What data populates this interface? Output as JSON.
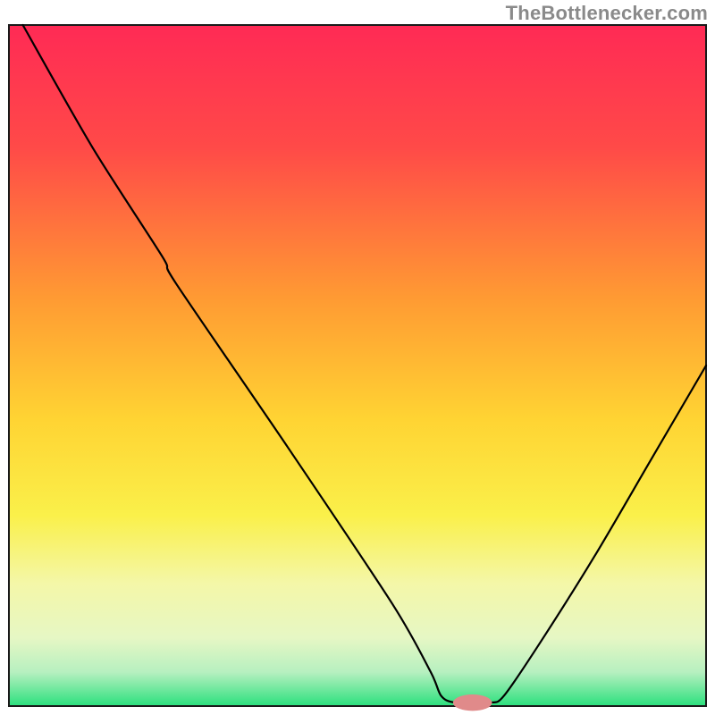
{
  "attribution": "TheBottlenecker.com",
  "chart_data": {
    "type": "line",
    "title": "",
    "xlabel": "",
    "ylabel": "",
    "xlim": [
      0,
      100
    ],
    "ylim": [
      0,
      100
    ],
    "background_gradient_stops": [
      {
        "offset": 0,
        "color": "#ff2a55"
      },
      {
        "offset": 18,
        "color": "#ff4a48"
      },
      {
        "offset": 40,
        "color": "#ff9a33"
      },
      {
        "offset": 58,
        "color": "#ffd433"
      },
      {
        "offset": 72,
        "color": "#faf04a"
      },
      {
        "offset": 82,
        "color": "#f4f7a8"
      },
      {
        "offset": 90,
        "color": "#e6f7c4"
      },
      {
        "offset": 95,
        "color": "#b7f0c0"
      },
      {
        "offset": 100,
        "color": "#2be07d"
      }
    ],
    "series": [
      {
        "name": "bottleneck-curve",
        "color": "#000000",
        "data": [
          {
            "x": 2.0,
            "y": 100.0
          },
          {
            "x": 12.0,
            "y": 82.0
          },
          {
            "x": 22.0,
            "y": 66.0
          },
          {
            "x": 24.0,
            "y": 62.0
          },
          {
            "x": 40.0,
            "y": 38.0
          },
          {
            "x": 55.0,
            "y": 15.0
          },
          {
            "x": 60.5,
            "y": 5.0
          },
          {
            "x": 62.0,
            "y": 1.5
          },
          {
            "x": 64.0,
            "y": 0.5
          },
          {
            "x": 69.0,
            "y": 0.5
          },
          {
            "x": 71.0,
            "y": 1.5
          },
          {
            "x": 76.0,
            "y": 9.0
          },
          {
            "x": 84.0,
            "y": 22.0
          },
          {
            "x": 92.0,
            "y": 36.0
          },
          {
            "x": 100.0,
            "y": 50.0
          }
        ]
      }
    ],
    "marker": {
      "name": "optimal-point",
      "x": 66.5,
      "y": 0.5,
      "rx": 2.8,
      "ry": 1.2,
      "color": "#e08a8a"
    },
    "legend": []
  }
}
